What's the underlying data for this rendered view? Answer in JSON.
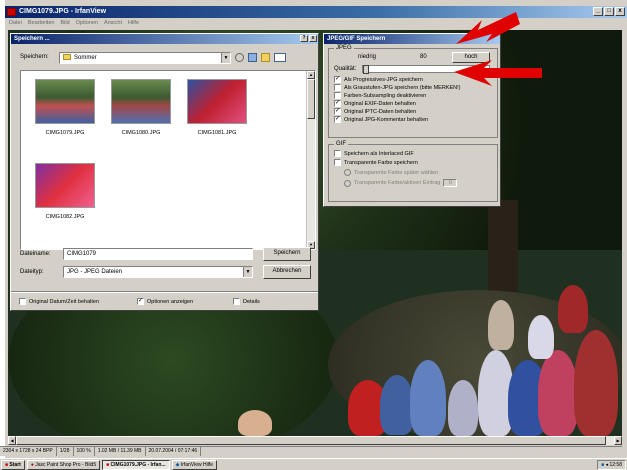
{
  "window": {
    "title": "CIMG1079.JPG - IrfanView",
    "controls": [
      "_",
      "□",
      "x"
    ]
  },
  "menu": [
    "Datei",
    "Bearbeiten",
    "Bild",
    "Optionen",
    "Ansicht",
    "Hilfe"
  ],
  "save_dialog": {
    "title": "Speichern ...",
    "title_buttons": [
      "?",
      "x"
    ],
    "save_in_label": "Speichern:",
    "save_in_value": "Sommer",
    "files": [
      {
        "name": "CIMG1079.JPG"
      },
      {
        "name": "CIMG1080.JPG"
      },
      {
        "name": "CIMG1081.JPG"
      },
      {
        "name": "CIMG1082.JPG"
      }
    ],
    "filename_label": "Dateiname:",
    "filename_value": "CIMG1079",
    "filetype_label": "Dateityp:",
    "filetype_value": "JPG - JPEG Dateien",
    "save_button": "Speichern",
    "cancel_button": "Abbrechen",
    "keep_date_label": "Original Datum/Zeit behalten",
    "keep_date_checked": false,
    "show_options_label": "Optionen anzeigen",
    "show_options_checked": true,
    "details_label": "Details",
    "details_checked": false
  },
  "jpeg_dialog": {
    "title": "JPEG/GIF Speichern",
    "jpeg_group": "JPEG",
    "low_label": "niedrig",
    "quality_value": "80",
    "high_label": "hoch",
    "quality_label": "Qualität:",
    "options": [
      {
        "label": "Als Progressives-JPG speichern",
        "checked": true
      },
      {
        "label": "Als Graustufen-JPG speichern (bitte MERKEN!)",
        "checked": false
      },
      {
        "label": "Farben-Subsampling deaktivieren",
        "checked": false
      },
      {
        "label": "Original EXIF-Daten behalten",
        "checked": true
      },
      {
        "label": "Original IPTC-Daten behalten",
        "checked": true
      },
      {
        "label": "Original JPG-Kommentar behalten",
        "checked": true
      }
    ],
    "gif_group": "GIF",
    "gif_options": [
      {
        "label": "Speichern als Interlaced GIF",
        "checked": false
      },
      {
        "label": "Transparente Farbe speichern",
        "checked": false
      }
    ],
    "radio_options": [
      {
        "label": "Transparente Farbe später wählen"
      },
      {
        "label": "Transparente Farbe/aktiven Eintrag",
        "value": "0"
      }
    ]
  },
  "statusbar": [
    "2304 x 1728 x 24 BPP",
    "1/28",
    "100 %",
    "1.02 MB / 11.39 MB",
    "20.07.2004 / 07:17:46"
  ],
  "taskbar": {
    "start": "Start",
    "items": [
      {
        "label": "Jasc Paint Shop Pro - Bild5",
        "active": false
      },
      {
        "label": "CIMG1079.JPG - Irfan...",
        "active": true
      },
      {
        "label": "IrfanView Hilfe",
        "active": false
      }
    ],
    "clock": "12:58"
  },
  "colors": {
    "titlebar": "#0a246a",
    "arrow": "#e00000",
    "dialog_bg": "#d4d0c8"
  }
}
